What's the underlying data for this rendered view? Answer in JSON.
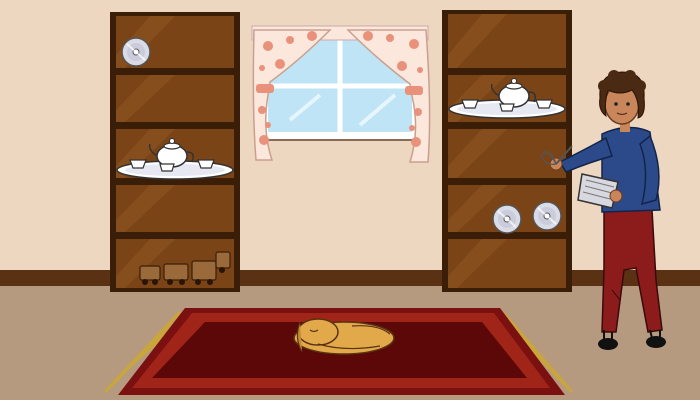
{
  "scene": {
    "colors": {
      "wall": "#f2dcc6",
      "wall_shadow": "#e4c9ae",
      "baseboard": "#5a3112",
      "floor": "#b59a80",
      "shelf_frame": "#3a1e08",
      "shelf_wood": "#7a4417",
      "shelf_inner": "#5c300d",
      "rug_outer": "#7a1010",
      "rug_border": "#a12419",
      "rug_inner": "#5c0808",
      "fringe": "#c9a63a",
      "dog": "#e2a94b",
      "window_sky": "#bfe4f5",
      "curtain": "#fbe7dc",
      "curtain_flower": "#e9917a",
      "shirt": "#2c4a8a",
      "pants": "#8c1b1b",
      "hair": "#4a2a12",
      "skin": "#c8865a"
    },
    "objects": [
      {
        "name": "cd-disc",
        "location": "left-shelf-top",
        "count": 1
      },
      {
        "name": "tea-set",
        "location": "left-shelf-middle",
        "count": 1
      },
      {
        "name": "toy-train",
        "location": "left-shelf-bottom",
        "count": 1
      },
      {
        "name": "tea-set",
        "location": "right-shelf-upper",
        "count": 1
      },
      {
        "name": "cd-disc",
        "location": "right-shelf-middle",
        "count": 2
      },
      {
        "name": "sleeping-dog",
        "location": "rug",
        "count": 1
      },
      {
        "name": "girl-with-book-and-whisk",
        "location": "right-foreground",
        "count": 1
      }
    ]
  }
}
